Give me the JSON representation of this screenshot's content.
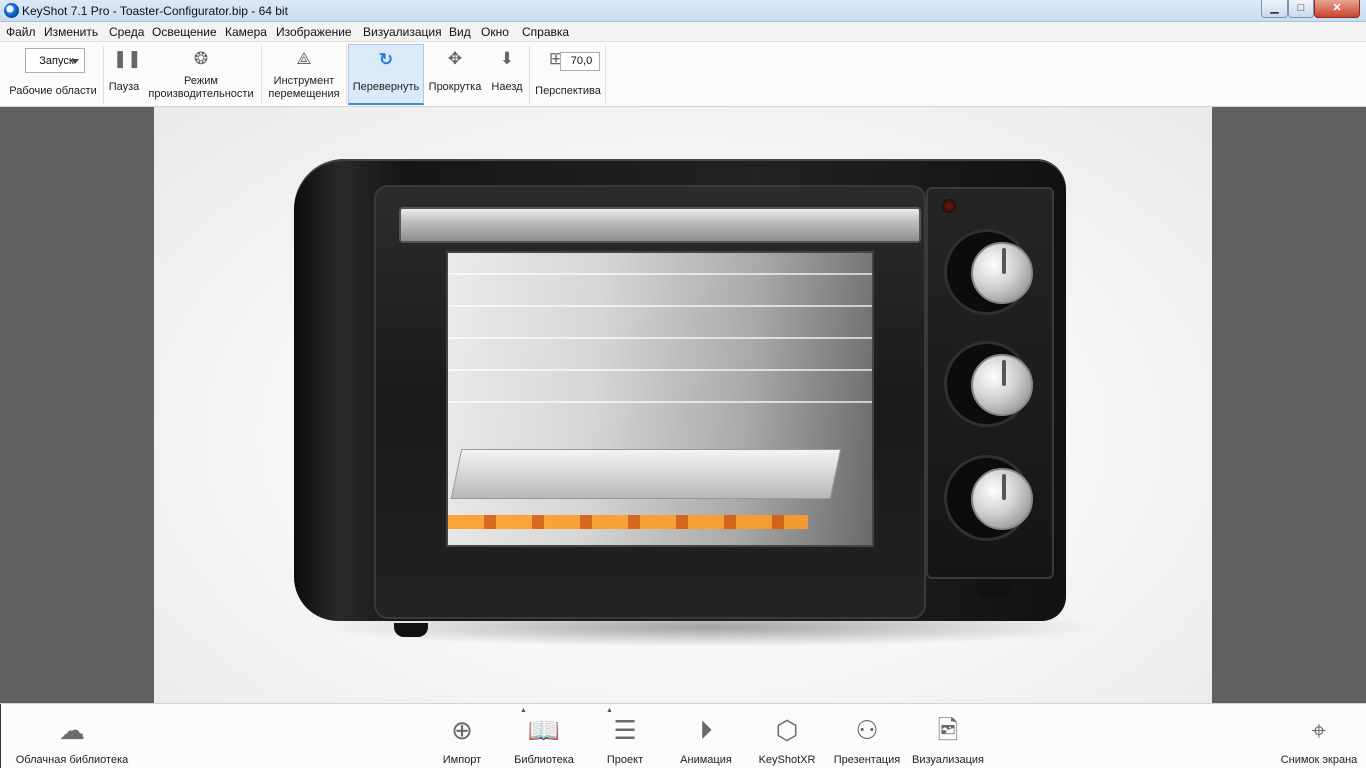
{
  "window": {
    "title": "KeyShot 7.1 Pro  - Toaster-Configurator.bip  - 64 bit",
    "minimize_glyph": "▁",
    "maximize_glyph": "□",
    "close_glyph": "✕"
  },
  "menu": [
    "Файл",
    "Изменить",
    "Среда",
    "Освещение",
    "Камера",
    "Изображение",
    "Визуализация",
    "Вид",
    "Окно",
    "Справка"
  ],
  "toolbar": {
    "workspace_select_value": "Запуск",
    "workspace_label": "Рабочие области",
    "pause_label": "Пауза",
    "performance_label_1": "Режим",
    "performance_label_2": "производительности",
    "move_tool_label_1": "Инструмент",
    "move_tool_label_2": "перемещения",
    "tumble_label": "Перевернуть",
    "pan_label": "Прокрутка",
    "dolly_label": "Наезд",
    "perspective_value": "70,0",
    "perspective_label": "Перспектива"
  },
  "bottom": {
    "cloud_library": "Облачная библиотека",
    "import": "Импорт",
    "library": "Библиотека",
    "project": "Проект",
    "animation": "Анимация",
    "keyshotxr": "KeyShotXR",
    "presentation": "Презентация",
    "render": "Визуализация",
    "screenshot": "Снимок экрана"
  },
  "icons": {
    "pause": "pause-icon",
    "performance": "performance-icon",
    "move": "move-tool-icon",
    "tumble": "tumble-icon",
    "pan": "pan-icon",
    "dolly": "dolly-icon",
    "perspective": "perspective-icon",
    "cloud": "cloud-library-icon",
    "import": "import-icon",
    "library": "library-icon",
    "project": "project-icon",
    "animation": "animation-icon",
    "keyshotxr": "keyshotxr-icon",
    "presentation": "presentation-icon",
    "render": "render-icon",
    "screenshot": "screenshot-icon"
  },
  "colors": {
    "accent": "#3b8ae0",
    "viewport_bg": "#606060",
    "render_bg": "#ffffff"
  }
}
